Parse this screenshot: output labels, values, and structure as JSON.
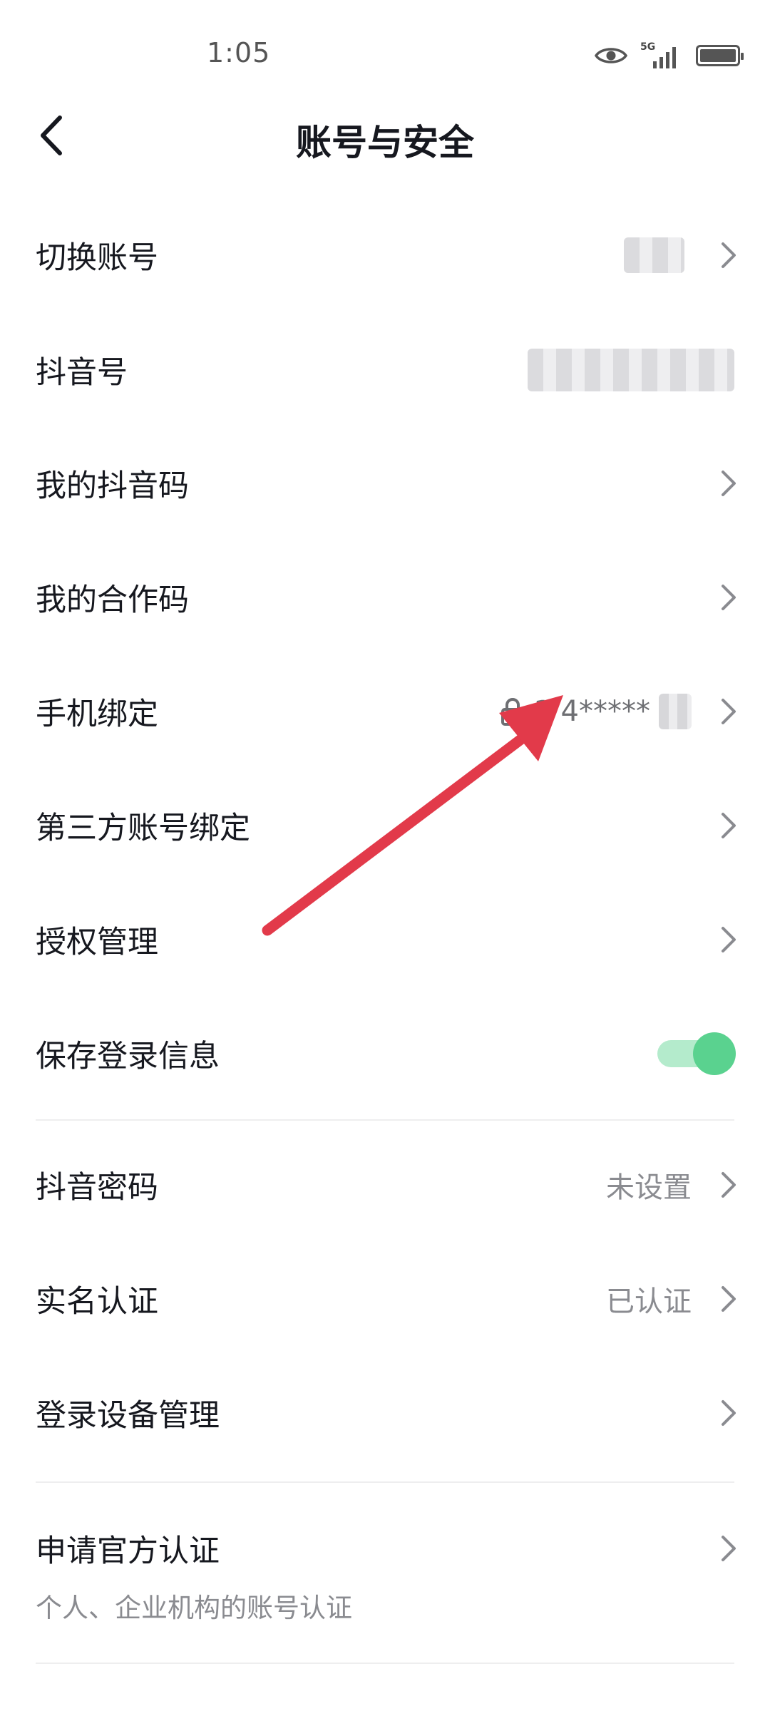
{
  "status_bar": {
    "time": "1:05",
    "icons": [
      "eye-icon",
      "5g-signal-icon",
      "battery-icon"
    ],
    "network_tag": "5G"
  },
  "header": {
    "title": "账号与安全",
    "back_icon": "chevron-left-icon"
  },
  "rows": {
    "switch_account": {
      "label": "切换账号"
    },
    "douyin_id": {
      "label": "抖音号"
    },
    "my_douyin_code": {
      "label": "我的抖音码"
    },
    "my_partner_code": {
      "label": "我的合作码"
    },
    "phone_binding": {
      "label": "手机绑定",
      "value": "1 4*****",
      "icon": "lock-icon"
    },
    "third_party_binding": {
      "label": "第三方账号绑定"
    },
    "authorization": {
      "label": "授权管理"
    },
    "save_login": {
      "label": "保存登录信息",
      "toggle_on": true
    },
    "douyin_password": {
      "label": "抖音密码",
      "value": "未设置"
    },
    "real_name": {
      "label": "实名认证",
      "value": "已认证"
    },
    "device_management": {
      "label": "登录设备管理"
    },
    "official_verification": {
      "label": "申请官方认证",
      "sublabel": "个人、企业机构的账号认证"
    }
  },
  "colors": {
    "text_primary": "#16181f",
    "text_secondary": "#8a8b90",
    "toggle_knob": "#5ad28f",
    "toggle_track": "#b4ebcc",
    "annotation_arrow": "#e23a4a",
    "divider": "#eeeeef"
  }
}
